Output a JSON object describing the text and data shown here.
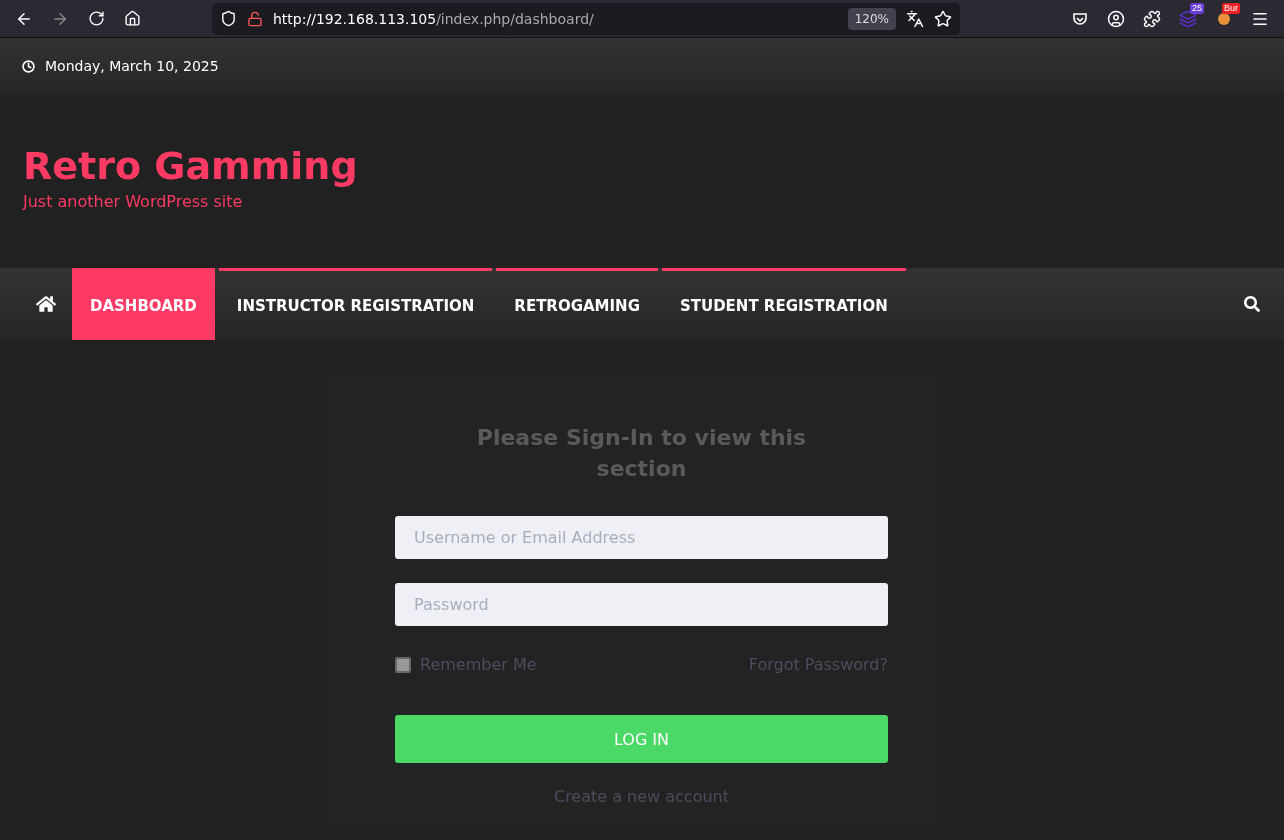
{
  "browser": {
    "url_host": "http://192.168.113.105",
    "url_path": "/index.php/dashboard/",
    "zoom": "120%",
    "extension_badges": [
      "25",
      "Bur"
    ]
  },
  "topbar": {
    "date": "Monday, March 10, 2025"
  },
  "site": {
    "title": "Retro Gamming",
    "tagline": "Just another WordPress site"
  },
  "nav": {
    "items": [
      {
        "label": "DASHBOARD",
        "selected": true,
        "has_submenu": false
      },
      {
        "label": "INSTRUCTOR REGISTRATION",
        "selected": false,
        "has_submenu": true
      },
      {
        "label": "RETROGAMING",
        "selected": false,
        "has_submenu": true
      },
      {
        "label": "STUDENT REGISTRATION",
        "selected": false,
        "has_submenu": true
      }
    ]
  },
  "login": {
    "heading": "Please Sign-In to view this section",
    "username": {
      "placeholder": "Username or Email Address"
    },
    "password": {
      "placeholder": "Password"
    },
    "remember": {
      "label": "Remember Me",
      "checked": false
    },
    "forgot": "Forgot Password?",
    "submit": "LOG IN",
    "register": "Create a new account"
  }
}
